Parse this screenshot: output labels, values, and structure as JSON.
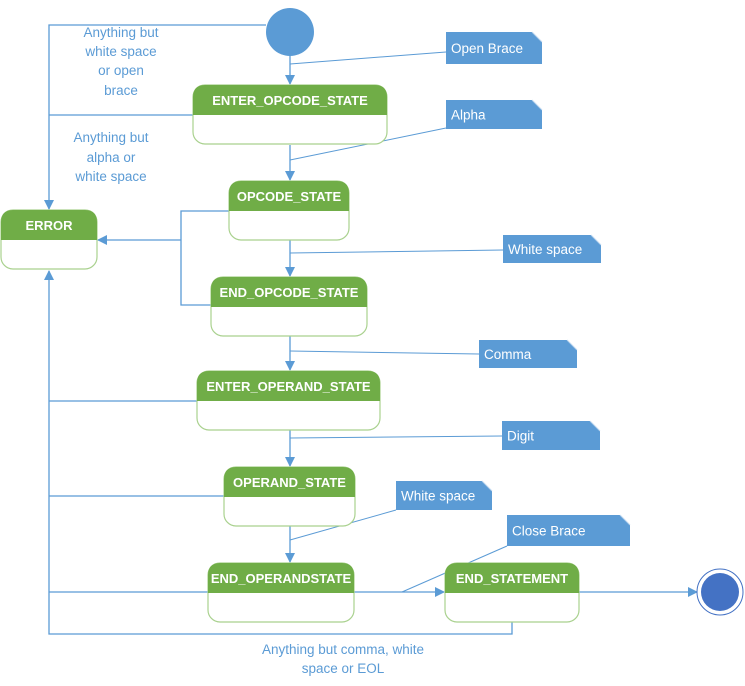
{
  "states": {
    "enter_opcode": "ENTER_OPCODE_STATE",
    "opcode": "OPCODE_STATE",
    "error": "ERROR",
    "end_opcode": "END_OPCODE_STATE",
    "enter_operand": "ENTER_OPERAND_STATE",
    "operand": "OPERAND_STATE",
    "end_operand": "END_OPERANDSTATE",
    "end_statement": "END_STATEMENT"
  },
  "notes": {
    "open_brace": "Open Brace",
    "alpha": "Alpha",
    "white_space_1": "White space",
    "comma": "Comma",
    "digit": "Digit",
    "white_space_2": "White space",
    "close_brace": "Close Brace"
  },
  "labels": {
    "start_error": [
      "Anything but",
      "white space",
      "or open",
      "brace"
    ],
    "enter_opcode_error": [
      "Anything but",
      "alpha  or",
      "white space"
    ],
    "end_statement_error": [
      "Anything but comma, white",
      "space or EOL"
    ]
  },
  "colors": {
    "state_header": "#70ad47",
    "state_border": "#a9d18e",
    "edge": "#5b9bd5",
    "note": "#5b9bd5",
    "final": "#4472c4"
  }
}
